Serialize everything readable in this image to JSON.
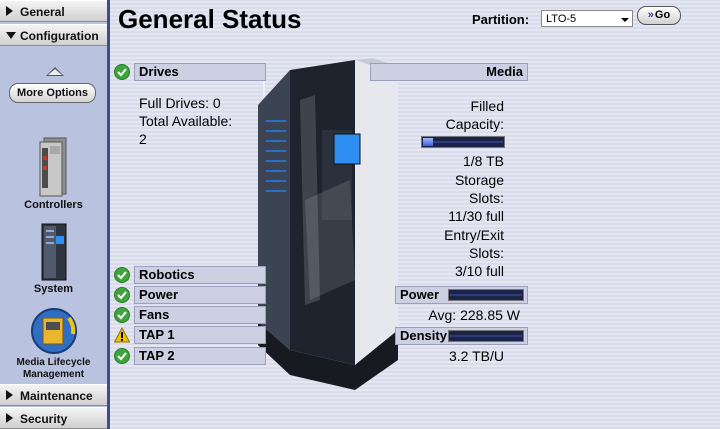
{
  "sidebar": {
    "general": "General",
    "configuration": "Configuration",
    "more_options": "More Options",
    "items": [
      {
        "label": "Controllers"
      },
      {
        "label": "System"
      },
      {
        "label": "Media Lifecycle Management"
      }
    ],
    "maintenance": "Maintenance",
    "security": "Security"
  },
  "header": {
    "title": "General Status",
    "partition_label": "Partition:",
    "partition_value": "LTO-5",
    "go_label": "Go"
  },
  "status": {
    "drives": {
      "label": "Drives",
      "state": "ok",
      "full": "Full Drives: 0",
      "available_1": "Total Available:",
      "available_2": "2"
    },
    "robotics": {
      "label": "Robotics",
      "state": "ok"
    },
    "power": {
      "label": "Power",
      "state": "ok"
    },
    "fans": {
      "label": "Fans",
      "state": "ok"
    },
    "tap1": {
      "label": "TAP 1",
      "state": "warning"
    },
    "tap2": {
      "label": "TAP 2",
      "state": "ok"
    }
  },
  "media": {
    "label": "Media",
    "filled_1": "Filled",
    "filled_2": "Capacity:",
    "filled_value": "1/8 TB",
    "filled_fraction": 0.125,
    "storage_1": "Storage",
    "storage_2": "Slots:",
    "storage_value": "11/30 full",
    "ee_1": "Entry/Exit",
    "ee_2": "Slots:",
    "ee_value": "3/10 full"
  },
  "power_meter": {
    "label": "Power",
    "value": "Avg: 228.85 W",
    "fraction": 0.0
  },
  "density_meter": {
    "label": "Density",
    "value": "3.2 TB/U",
    "fraction": 0.0
  },
  "colors": {
    "ok": "#3ea53e",
    "warning": "#f0c400",
    "accent": "#3d4f8a"
  }
}
